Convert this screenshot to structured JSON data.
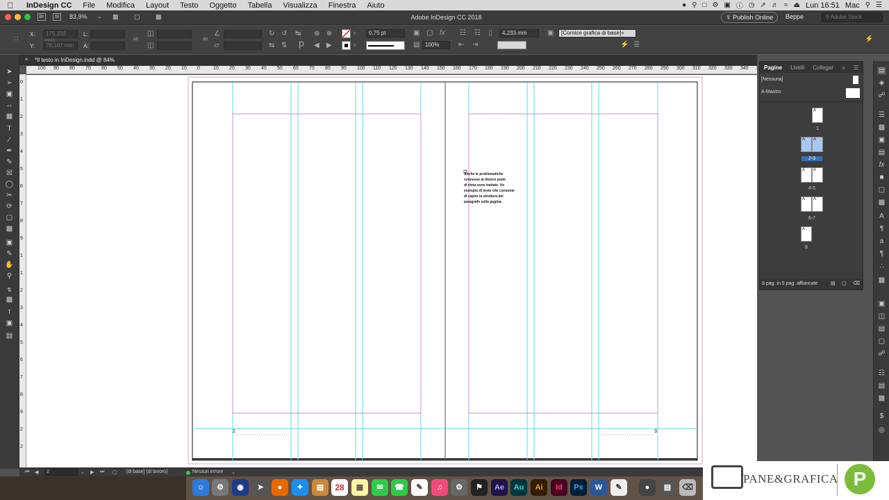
{
  "menubar": {
    "app": "InDesign CC",
    "items": [
      "File",
      "Modifica",
      "Layout",
      "Testo",
      "Oggetto",
      "Tabella",
      "Visualizza",
      "Finestra",
      "Aiuto"
    ],
    "clock": "Lun 16:51",
    "user": "Mac"
  },
  "titlebar": {
    "zoom": "83,9%",
    "title": "Adobe InDesign CC 2018",
    "publish_label": "Publish Online",
    "workspace": "Beppe",
    "stock_placeholder": "Adobe Stock"
  },
  "control": {
    "x_label": "X:",
    "x_value": "175,333 mm",
    "y_label": "Y:",
    "y_value": "78,107 mm",
    "l_label": "L:",
    "a_label": "A:",
    "stroke_weight": "0,75 pt",
    "opacity": "100%",
    "gutter": "4,233 mm",
    "object_style": "[Cornice grafica di base]+"
  },
  "document": {
    "tab_title": "*Il testo in InDesign.indd @ 84%",
    "folio_left": "2",
    "folio_right": "3",
    "text_frame_lines": [
      "Anche le problematiche",
      "connesse ai diversi punti",
      "di vista sono trattate. Un",
      "esempio di testo che consente",
      "di capire la struttura del",
      "paragrafo sulla pagina."
    ]
  },
  "ruler": {
    "h_ticks": [
      "100",
      "90",
      "80",
      "70",
      "60",
      "50",
      "40",
      "30",
      "20",
      "10",
      "0",
      "10",
      "20",
      "30",
      "40",
      "50",
      "60",
      "70",
      "80",
      "90",
      "100",
      "110",
      "120",
      "130",
      "140",
      "150",
      "160",
      "170",
      "180",
      "190",
      "200",
      "210",
      "220",
      "230",
      "240",
      "250",
      "260",
      "270",
      "280",
      "290",
      "300",
      "310",
      "320",
      "330",
      "340",
      "350"
    ],
    "v_ticks": [
      "0",
      "1",
      "2",
      "3",
      "4",
      "5",
      "6",
      "7",
      "8",
      "9",
      "1",
      "1",
      "2",
      "3",
      "4",
      "5",
      "6",
      "7",
      "8",
      "9",
      "2",
      "2"
    ]
  },
  "status": {
    "page": "2",
    "master": "[di base] (di lavoro)",
    "preflight": "Nessun errore"
  },
  "pages_panel": {
    "tabs": [
      "Pagine",
      "Livelli",
      "Collegar"
    ],
    "none_label": "[Nessuna]",
    "master_label": "A-Mastro",
    "spreads": [
      {
        "label": "1",
        "selected": false
      },
      {
        "label": "2-3",
        "selected": true
      },
      {
        "label": "4-5",
        "selected": false
      },
      {
        "label": "6-7",
        "selected": false
      },
      {
        "label": "8",
        "selected": false
      }
    ],
    "footer": "8 pag. in 5 pag. affiancate"
  },
  "dock": {
    "calendar_day": "28",
    "apps": [
      "Ae",
      "Au",
      "Ai",
      "Id",
      "Ps",
      "W"
    ]
  },
  "brand": {
    "name": "PANE&GRAFICA",
    "logo_letter": "P"
  },
  "colors": {
    "guide_cyan": "#5fd7ec",
    "margin_magenta": "#c88fc8",
    "accent_blue": "#a8c8f0",
    "brand_green": "#7bbd3a"
  }
}
